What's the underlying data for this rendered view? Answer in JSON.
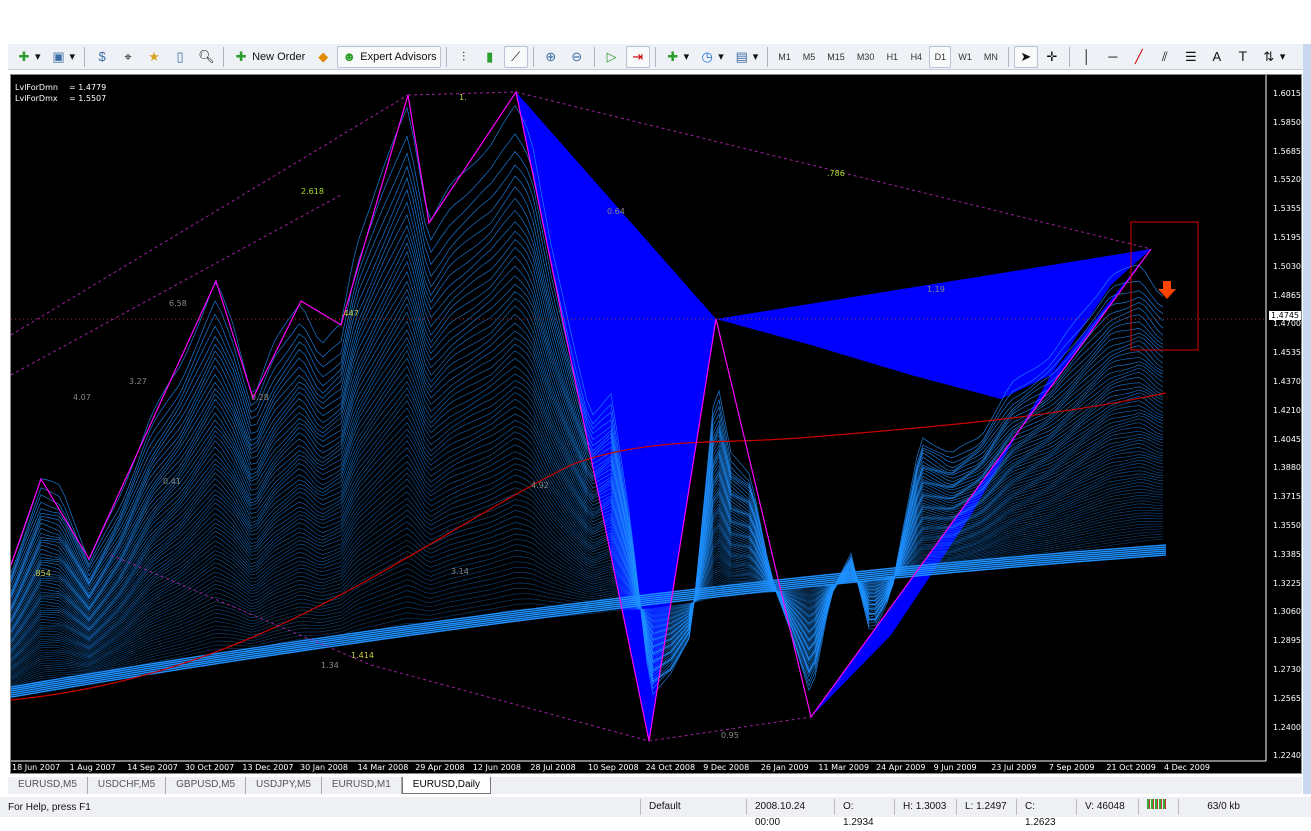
{
  "toolbar": {
    "new_order": "New Order",
    "expert_advisors": "Expert Advisors",
    "timeframes": [
      "M1",
      "M5",
      "M15",
      "M30",
      "H1",
      "H4",
      "D1",
      "W1",
      "MN"
    ],
    "active_timeframe": "D1"
  },
  "chart": {
    "symbol": "EURUSD,Daily",
    "info": [
      {
        "name": "LvlForDmn",
        "value": "= 1.4779"
      },
      {
        "name": "LvlForDmx",
        "value": "= 1.5507"
      }
    ],
    "current_price": "1.4745",
    "price_axis": [
      "1.6015",
      "1.5850",
      "1.5685",
      "1.5520",
      "1.5355",
      "1.5195",
      "1.5030",
      "1.4865",
      "1.4700",
      "1.4535",
      "1.4370",
      "1.4210",
      "1.4045",
      "1.3880",
      "1.3715",
      "1.3550",
      "1.3385",
      "1.3225",
      "1.3060",
      "1.2895",
      "1.2730",
      "1.2565",
      "1.2400",
      "1.2240"
    ],
    "date_axis": [
      "18 Jun 2007",
      "1 Aug 2007",
      "14 Sep 2007",
      "30 Oct 2007",
      "13 Dec 2007",
      "30 Jan 2008",
      "14 Mar 2008",
      "29 Apr 2008",
      "12 Jun 2008",
      "28 Jul 2008",
      "10 Sep 2008",
      "24 Oct 2008",
      "9 Dec 2008",
      "26 Jan 2009",
      "11 Mar 2009",
      "24 Apr 2009",
      "9 Jun 2009",
      "23 Jul 2009",
      "7 Sep 2009",
      "21 Oct 2009",
      "4 Dec 2009"
    ],
    "fib_labels": [
      "1.",
      ".786",
      "2.618",
      "0.64",
      "6.58",
      "3.27",
      "4.07",
      "0.28",
      ".447",
      "0.41",
      ".854",
      "4.92",
      "3.14",
      "1.34",
      "1.414",
      "0.95",
      "1.19"
    ],
    "colors": {
      "mesh": "#1e90ff",
      "fill": "#0000ff",
      "zigzag": "#ff00ff",
      "ma": "#cc0000",
      "alert": "#ff4400"
    }
  },
  "tabs": [
    "EURUSD,M5",
    "USDCHF,M5",
    "GBPUSD,M5",
    "USDJPY,M5",
    "EURUSD,M1",
    "EURUSD,Daily"
  ],
  "active_tab": "EURUSD,Daily",
  "status": {
    "help": "For Help, press F1",
    "profile": "Default",
    "datetime": "2008.10.24 00:00",
    "open": "O: 1.2934",
    "high": "H: 1.3003",
    "low": "L: 1.2497",
    "close": "C: 1.2623",
    "volume": "V: 46048",
    "traffic": "63/0 kb"
  }
}
